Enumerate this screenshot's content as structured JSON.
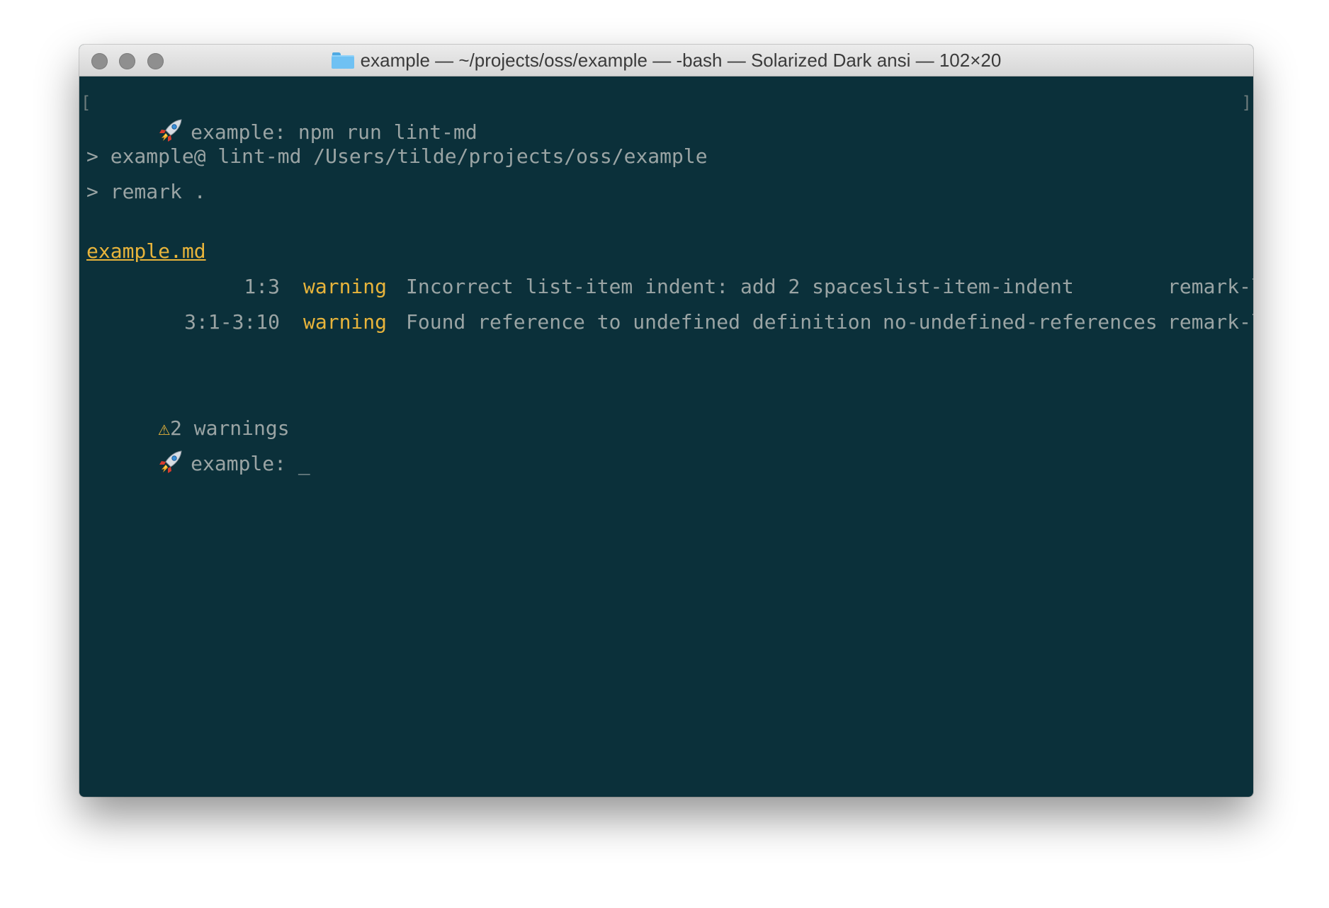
{
  "window": {
    "title": "example — ~/projects/oss/example — -bash — Solarized Dark ansi — 102×20",
    "folder_icon": "folder-icon",
    "background": "#0b303a",
    "accent": "#e8b43b"
  },
  "terminal": {
    "prompt_line": {
      "icon": "rocket-icon",
      "text": "example: npm run lint-md",
      "bracket_left": "[",
      "bracket_right": "]"
    },
    "script_header_1": "> example@ lint-md /Users/tilde/projects/oss/example",
    "script_header_2": "> remark .",
    "file_name": "example.md",
    "messages": [
      {
        "position": "1:3",
        "severity": "warning",
        "message": "Incorrect list-item indent: add 2 spaces",
        "rule": "list-item-indent",
        "source": "remark-lint"
      },
      {
        "position": "3:1-3:10",
        "severity": "warning",
        "message": "Found reference to undefined definition",
        "rule": "no-undefined-references",
        "source": "remark-lint"
      }
    ],
    "summary": {
      "icon": "⚠",
      "text": "2 warnings"
    },
    "final_prompt": {
      "icon": "rocket-icon",
      "text": "example:",
      "cursor": "_"
    }
  }
}
